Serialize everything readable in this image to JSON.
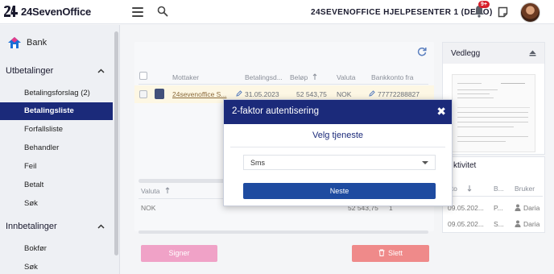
{
  "header": {
    "logo_text": "24SevenOffice",
    "company": "24SEVENOFFICE HJELPESENTER 1 (DEMO)",
    "notification_badge": "9+"
  },
  "sidebar": {
    "module": "Bank",
    "sections": [
      {
        "label": "Utbetalinger",
        "items": [
          {
            "label": "Betalingsforslag (2)"
          },
          {
            "label": "Betalingsliste",
            "active": true
          },
          {
            "label": "Forfallsliste"
          },
          {
            "label": "Behandler"
          },
          {
            "label": "Feil"
          },
          {
            "label": "Betalt"
          },
          {
            "label": "Søk"
          }
        ]
      },
      {
        "label": "Innbetalinger",
        "items": [
          {
            "label": "Bokfør"
          },
          {
            "label": "Søk"
          }
        ]
      }
    ]
  },
  "payments_table": {
    "columns": [
      "Mottaker",
      "Betalingsd...",
      "Beløp",
      "Valuta",
      "Bankkonto fra"
    ],
    "rows": [
      {
        "mottaker": "24sevenoffice S...",
        "dato": "31.05.2023",
        "belop": "52 543,75",
        "valuta": "NOK",
        "konto": "77772288827"
      }
    ]
  },
  "summary_table": {
    "columns": [
      "Valuta"
    ],
    "rows": [
      {
        "valuta": "NOK",
        "belop": "52 543,75",
        "antall": "1"
      }
    ]
  },
  "actions": {
    "signer_label": "Signer",
    "slett_label": "Slett"
  },
  "attachments": {
    "title": "Vedlegg"
  },
  "activity": {
    "title": "Aktivitet",
    "title_visible": "ktivitet",
    "columns": [
      "Dato",
      "B...",
      "Bruker"
    ],
    "columns_visible": [
      "ato",
      "B...",
      "Bruker"
    ],
    "rows": [
      {
        "dato": "09.05.202...",
        "b": "P...",
        "bruker": "Daria"
      },
      {
        "dato": "09.05.202...",
        "b": "S...",
        "bruker": "Daria"
      }
    ]
  },
  "modal": {
    "title": "2-faktor autentisering",
    "subtitle": "Velg tjeneste",
    "select_value": "Sms",
    "next_label": "Neste"
  },
  "colors": {
    "brand_navy": "#1b2a7a",
    "primary_button": "#1e4ba0",
    "signer_pink": "#f0a2c7",
    "delete_red": "#ef8a8a",
    "badge_red": "#d71f2b"
  }
}
